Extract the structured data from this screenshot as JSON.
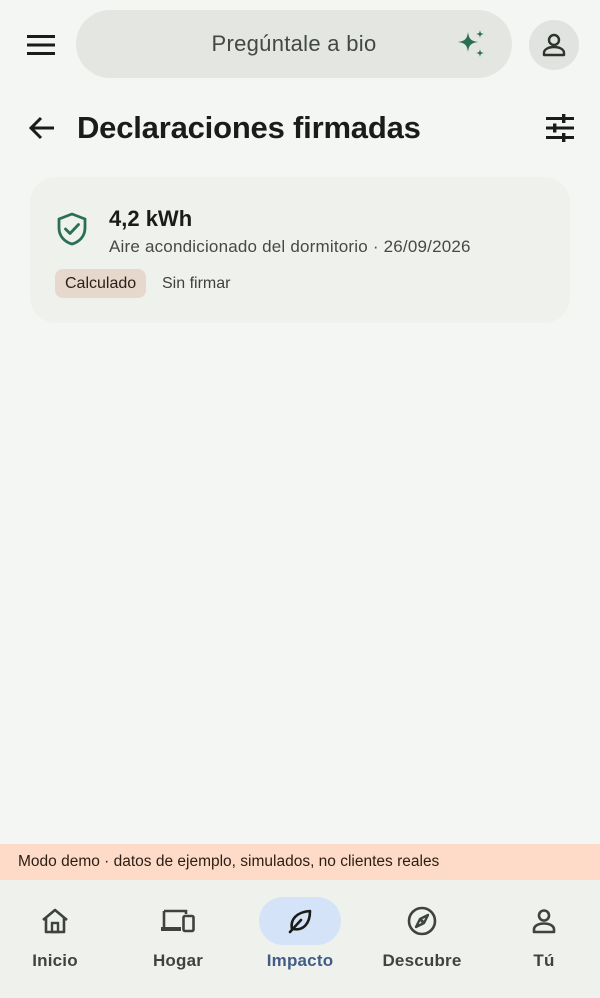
{
  "topbar": {
    "menu_icon": "menu-icon",
    "search_placeholder": "Pregúntale a bio",
    "sparkle_icon": "sparkle-icon",
    "account_icon": "person-icon"
  },
  "header": {
    "back_icon": "arrow-back-icon",
    "title": "Declaraciones firmadas",
    "filter_icon": "tune-icon"
  },
  "declarations": [
    {
      "icon": "verified-shield-icon",
      "value": "4,2 kWh",
      "subtitle": "Aire acondicionado del dormitorio · 26/09/2026",
      "chip": "Calculado",
      "status": "Sin firmar"
    }
  ],
  "banner": {
    "text": "Modo demo · datos de ejemplo, simulados, no clientes reales"
  },
  "nav": {
    "items": [
      {
        "label": "Inicio",
        "icon": "home-icon"
      },
      {
        "label": "Hogar",
        "icon": "devices-icon"
      },
      {
        "label": "Impacto",
        "icon": "leaf-icon",
        "active": true
      },
      {
        "label": "Descubre",
        "icon": "compass-icon"
      },
      {
        "label": "Tú",
        "icon": "person-icon"
      }
    ]
  },
  "colors": {
    "background": "#f4f6f3",
    "accent_green": "#2b6e57",
    "nav_active_pill": "#d4e3f7",
    "nav_active_text": "#415d86",
    "chip_bg": "#e7d8cd",
    "banner_bg": "#fedbc8"
  }
}
